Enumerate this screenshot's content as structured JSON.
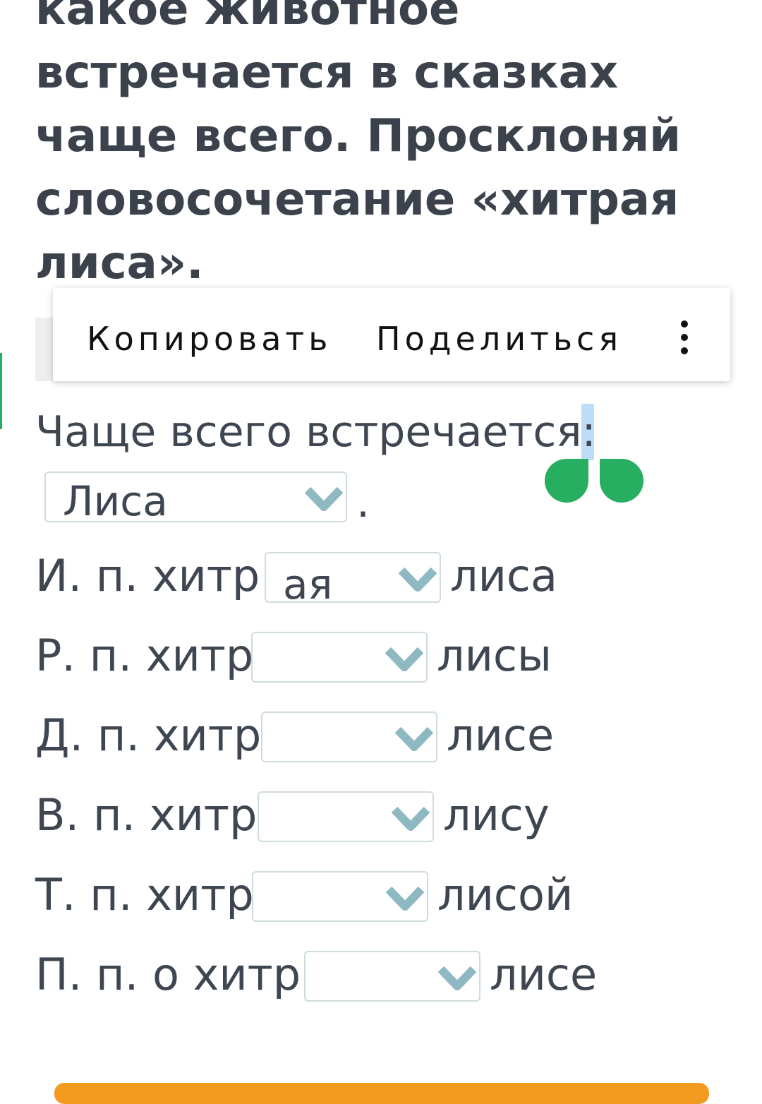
{
  "task": {
    "title_lines": [
      "какое животное",
      "встречается в сказках",
      "чаще всего. Просклоняй",
      "словосочетание «хитрая",
      "лиса»."
    ]
  },
  "context_menu": {
    "copy_label": "Копировать",
    "share_label": "Поделиться",
    "more_icon": "more-vertical-icon"
  },
  "answer": {
    "text": "Чаще всего встречается",
    "selected_char": ":",
    "animal_value": "Лиса",
    "period": "."
  },
  "declension": {
    "rows": [
      {
        "label": "И. п. хитр",
        "value": "ая",
        "noun": "лиса"
      },
      {
        "label": "Р. п. хитр",
        "value": "",
        "noun": "лисы"
      },
      {
        "label": "Д. п. хитр",
        "value": "",
        "noun": "лисе"
      },
      {
        "label": "В. п. хитр",
        "value": "",
        "noun": "лису"
      },
      {
        "label": "Т. п. хитр",
        "value": "",
        "noun": "лисой"
      },
      {
        "label": "П. п. о хитр",
        "value": "",
        "noun": "лисе"
      }
    ]
  },
  "colors": {
    "accent_green": "#27ae60",
    "chevron": "#8fb9c2",
    "button_orange": "#f39a21",
    "text": "#3d4651"
  }
}
